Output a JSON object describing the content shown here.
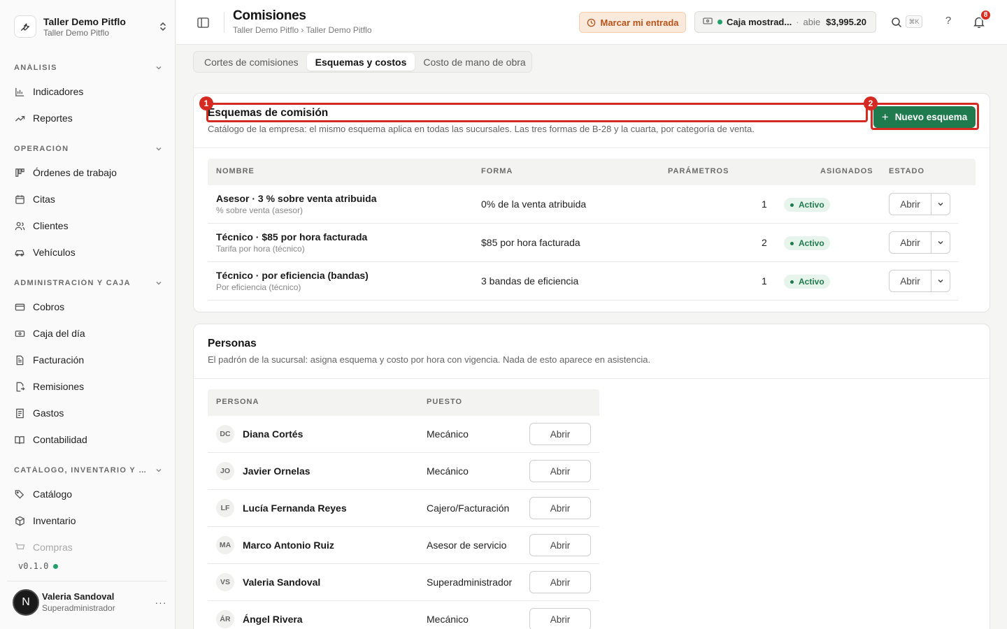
{
  "org": {
    "name": "Taller Demo Pitflo",
    "sub": "Taller Demo Pitflo"
  },
  "sidebar": {
    "sections": [
      {
        "title": "ANÁLISIS",
        "items": [
          "Indicadores",
          "Reportes"
        ]
      },
      {
        "title": "OPERACIÓN",
        "items": [
          "Órdenes de trabajo",
          "Citas",
          "Clientes",
          "Vehículos"
        ]
      },
      {
        "title": "ADMINISTRACIÓN Y CAJA",
        "items": [
          "Cobros",
          "Caja del día",
          "Facturación",
          "Remisiones",
          "Gastos",
          "Contabilidad"
        ]
      },
      {
        "title": "CATÁLOGO, INVENTARIO Y CO...",
        "items": [
          "Catálogo",
          "Inventario",
          "Compras"
        ]
      }
    ],
    "version": "v0.1.0",
    "user": {
      "initial": "N",
      "name": "Valeria Sandoval",
      "role": "Superadministrador",
      "more": "···"
    }
  },
  "header": {
    "title": "Comisiones",
    "breadcrumb": "Taller Demo Pitflo › Taller Demo Pitflo",
    "punch_label": "Marcar mi entrada",
    "cash": {
      "name": "Caja mostrad...",
      "sep": "·",
      "state": "abie",
      "amount": "$3,995.20"
    },
    "shortcut": "⌘K",
    "help": "?",
    "notifications": "8"
  },
  "tabs": [
    {
      "label": "Cortes de comisiones",
      "active": false
    },
    {
      "label": "Esquemas y costos",
      "active": true
    },
    {
      "label": "Costo de mano de obra",
      "active": false
    }
  ],
  "schemes": {
    "title": "Esquemas de comisión",
    "description": "Catálogo de la empresa: el mismo esquema aplica en todas las sucursales. Las tres formas de B-28 y la cuarta, por categoría de venta.",
    "new_button": "Nuevo esquema",
    "markers": [
      "1",
      "2"
    ],
    "columns": [
      "NOMBRE",
      "FORMA",
      "PARÁMETROS",
      "ASIGNADOS",
      "ESTADO"
    ],
    "rows": [
      {
        "name": "Asesor · 3 % sobre venta atribuida",
        "type": "% sobre venta (asesor)",
        "form": "0% de la venta atribuida",
        "assigned": "1",
        "status": "Activo",
        "action": "Abrir"
      },
      {
        "name": "Técnico · $85 por hora facturada",
        "type": "Tarifa por hora (técnico)",
        "form": "$85 por hora facturada",
        "assigned": "2",
        "status": "Activo",
        "action": "Abrir"
      },
      {
        "name": "Técnico · por eficiencia (bandas)",
        "type": "Por eficiencia (técnico)",
        "form": "3 bandas de eficiencia",
        "assigned": "1",
        "status": "Activo",
        "action": "Abrir"
      }
    ]
  },
  "people": {
    "title": "Personas",
    "description": "El padrón de la sucursal: asigna esquema y costo por hora con vigencia. Nada de esto aparece en asistencia.",
    "columns": [
      "PERSONA",
      "PUESTO"
    ],
    "rows": [
      {
        "initials": "DC",
        "name": "Diana Cortés",
        "role": "Mecánico",
        "action": "Abrir"
      },
      {
        "initials": "JO",
        "name": "Javier Ornelas",
        "role": "Mecánico",
        "action": "Abrir"
      },
      {
        "initials": "LF",
        "name": "Lucía Fernanda Reyes",
        "role": "Cajero/Facturación",
        "action": "Abrir"
      },
      {
        "initials": "MA",
        "name": "Marco Antonio Ruiz",
        "role": "Asesor de servicio",
        "action": "Abrir"
      },
      {
        "initials": "VS",
        "name": "Valeria Sandoval",
        "role": "Superadministrador",
        "action": "Abrir"
      },
      {
        "initials": "ÁR",
        "name": "Ángel Rivera",
        "role": "Mecánico",
        "action": "Abrir"
      }
    ]
  },
  "colors": {
    "accent": "#1f7a4d",
    "marker": "#d42a21",
    "status": "#22a06b"
  }
}
